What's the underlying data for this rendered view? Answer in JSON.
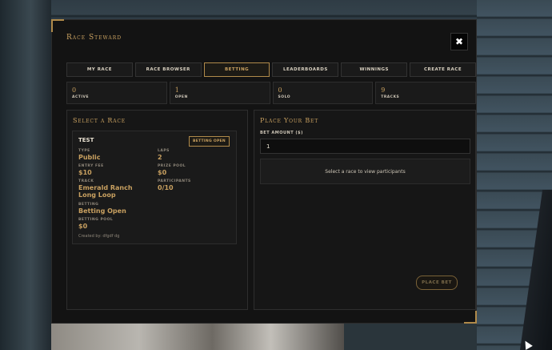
{
  "window": {
    "title": "Race Steward",
    "close_glyph": "✖"
  },
  "tabs": [
    {
      "label": "My Race"
    },
    {
      "label": "Race Browser"
    },
    {
      "label": "Betting",
      "active": true
    },
    {
      "label": "Leaderboards"
    },
    {
      "label": "Winnings"
    },
    {
      "label": "Create Race"
    }
  ],
  "stats": [
    {
      "value": "0",
      "label": "Active"
    },
    {
      "value": "1",
      "label": "Open"
    },
    {
      "value": "0",
      "label": "Solo"
    },
    {
      "value": "9",
      "label": "Tracks"
    }
  ],
  "select_race": {
    "title": "Select a Race",
    "race": {
      "name": "TEST",
      "badge": "Betting Open",
      "type_label": "Type",
      "type": "Public",
      "laps_label": "Laps",
      "laps": "2",
      "entry_fee_label": "Entry Fee",
      "entry_fee": "$10",
      "prize_pool_label": "Prize Pool",
      "prize_pool": "$0",
      "track_label": "Track",
      "track": "Emerald Ranch Long Loop",
      "participants_label": "Participants",
      "participants": "0/10",
      "betting_label": "Betting",
      "betting": "Betting Open",
      "betting_pool_label": "Betting Pool",
      "betting_pool": "$0",
      "created_by": "Created by: dfgdf dg"
    }
  },
  "place_bet": {
    "title": "Place Your Bet",
    "amount_label": "Bet Amount ($)",
    "amount_value": "1",
    "participants_placeholder": "Select a race to view participants",
    "button_label": "Place Bet"
  },
  "colors": {
    "accent": "#c8a060",
    "panel": "#131313"
  }
}
